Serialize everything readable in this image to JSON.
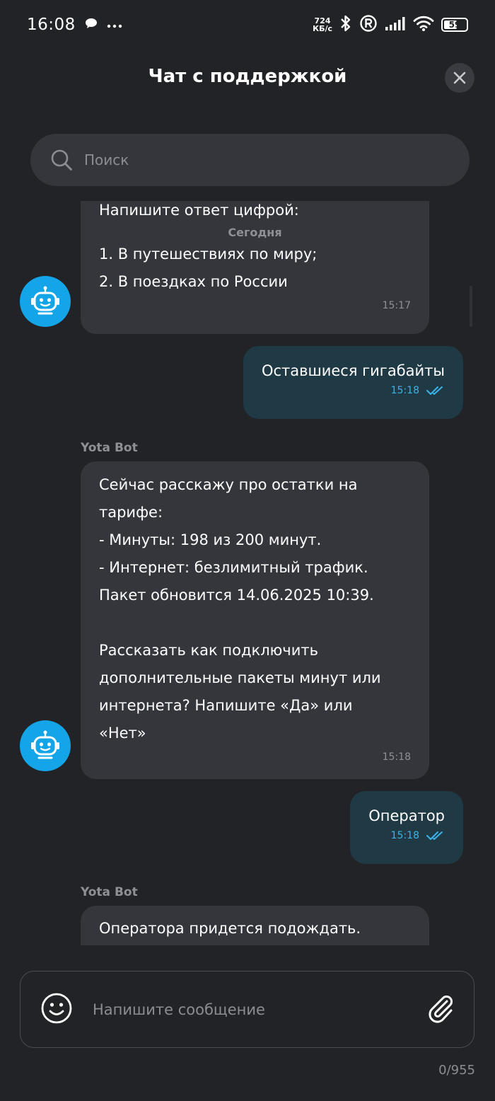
{
  "status_bar": {
    "time": "16:08",
    "speed_value": "724",
    "speed_unit": "КБ/с",
    "battery": "59",
    "battery_level": 0.59,
    "icons": [
      "chat-notification-icon",
      "more-dots-icon",
      "bluetooth-icon",
      "registered-icon",
      "signal-icon",
      "wifi-icon",
      "battery-icon"
    ]
  },
  "header": {
    "title": "Чат с поддержкой"
  },
  "search": {
    "placeholder": "Поиск"
  },
  "messages": [
    {
      "type": "incoming",
      "text_top": "Напишите ответ цифрой:",
      "date_separator": "Сегодня",
      "text": "1. В путешествиях по миру;\n2. В поездках по России",
      "time": "15:17"
    },
    {
      "type": "outgoing",
      "text": "Оставшиеся гигабайты",
      "time": "15:18"
    },
    {
      "type": "incoming",
      "sender": "Yota Bot",
      "text": "Сейчас расскажу про остатки на\nтарифе:\n- Минуты: 198 из 200 минут.\n- Интернет: безлимитный трафик.\nПакет обновится 14.06.2025 10:39.\n\nРассказать как подключить\nдополнительные пакеты минут или\nинтернета? Напишите «Да» или\n«Нет»",
      "time": "15:18"
    },
    {
      "type": "outgoing",
      "text": "Оператор",
      "time": "15:18"
    },
    {
      "type": "incoming",
      "sender": "Yota Bot",
      "text": "Оператора придется подождать."
    }
  ],
  "composer": {
    "placeholder": "Напишите сообщение",
    "counter": "0/955"
  },
  "colors": {
    "background": "#222327",
    "incoming_bubble": "#35363c",
    "outgoing_bubble": "#1f3a45",
    "accent": "#13a5e8",
    "read_ticks": "#3ab3e8"
  }
}
